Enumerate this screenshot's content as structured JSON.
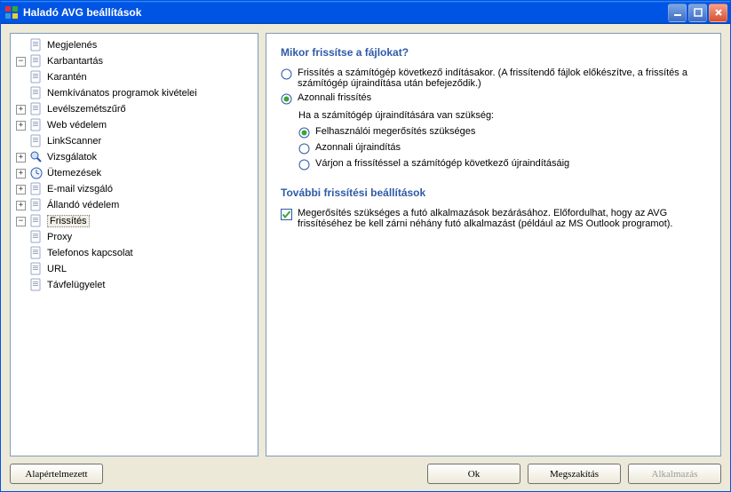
{
  "window": {
    "title": "Haladó AVG beállítások"
  },
  "tree": {
    "items": [
      {
        "label": "Megjelenés"
      },
      {
        "label": "Karbantartás",
        "children": [
          {
            "label": "Karantén"
          }
        ],
        "expanded": true
      },
      {
        "label": "Nemkívánatos programok kivételei"
      },
      {
        "label": "Levélszemétszűrő",
        "hasChildren": true
      },
      {
        "label": "Web védelem",
        "hasChildren": true
      },
      {
        "label": "LinkScanner"
      },
      {
        "label": "Vizsgálatok",
        "hasChildren": true
      },
      {
        "label": "Ütemezések",
        "hasChildren": true
      },
      {
        "label": "E-mail vizsgáló",
        "hasChildren": true
      },
      {
        "label": "Állandó védelem",
        "hasChildren": true
      },
      {
        "label": "Frissítés",
        "selected": true,
        "expanded": true,
        "children": [
          {
            "label": "Proxy"
          },
          {
            "label": "Telefonos kapcsolat"
          },
          {
            "label": "URL"
          }
        ]
      },
      {
        "label": "Távfelügyelet"
      }
    ]
  },
  "content": {
    "section1_title": "Mikor frissítse a fájlokat?",
    "opt_boot": "Frissítés a számítógép következő indításakor. (A frissítendő fájlok előkészítve, a frissítés a számítógép újraindítása után befejeződik.)",
    "opt_immediate": "Azonnali frissítés",
    "restart_note": "Ha a számítógép újraindítására van szükség:",
    "sub_confirm": "Felhasználói megerősítés szükséges",
    "sub_restart": "Azonnali újraindítás",
    "sub_wait": "Várjon a frissítéssel a számítógép következő újraindításáig",
    "section2_title": "További frissítési beállítások",
    "chk_close": "Megerősítés szükséges a futó alkalmazások bezárásához. Előfordulhat, hogy az AVG frissítéséhez be kell zárni néhány futó alkalmazást (például az MS Outlook programot).",
    "selected_main": "immediate",
    "selected_sub": "confirm",
    "chk_close_checked": true
  },
  "buttons": {
    "default": "Alapértelmezett",
    "ok": "Ok",
    "cancel": "Megszakítás",
    "apply": "Alkalmazás"
  },
  "icons": {
    "page": "page-icon",
    "magnify": "magnify-icon",
    "clock": "clock-icon"
  }
}
